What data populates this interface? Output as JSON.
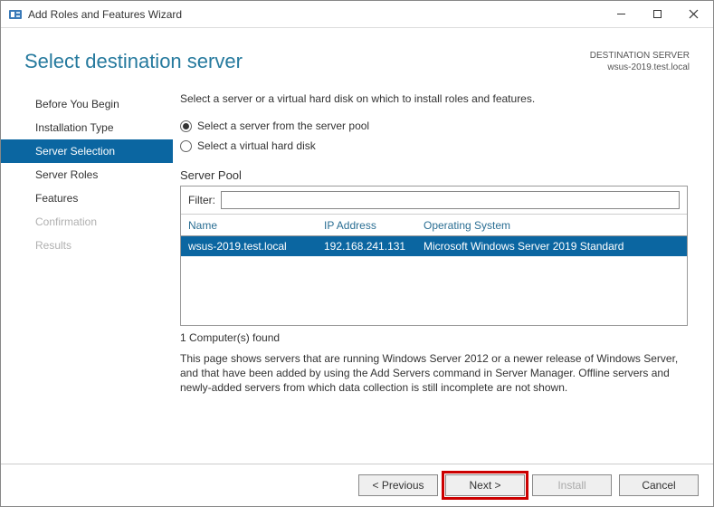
{
  "window": {
    "title": "Add Roles and Features Wizard"
  },
  "header": {
    "page_title": "Select destination server",
    "destination_label": "DESTINATION SERVER",
    "destination_value": "wsus-2019.test.local"
  },
  "sidebar": {
    "items": [
      {
        "label": "Before You Begin",
        "state": "normal"
      },
      {
        "label": "Installation Type",
        "state": "normal"
      },
      {
        "label": "Server Selection",
        "state": "active"
      },
      {
        "label": "Server Roles",
        "state": "normal"
      },
      {
        "label": "Features",
        "state": "normal"
      },
      {
        "label": "Confirmation",
        "state": "disabled"
      },
      {
        "label": "Results",
        "state": "disabled"
      }
    ]
  },
  "main": {
    "instruction": "Select a server or a virtual hard disk on which to install roles and features.",
    "radios": [
      {
        "label": "Select a server from the server pool",
        "selected": true
      },
      {
        "label": "Select a virtual hard disk",
        "selected": false
      }
    ],
    "pool_label": "Server Pool",
    "filter_label": "Filter:",
    "filter_value": "",
    "columns": {
      "name": "Name",
      "ip": "IP Address",
      "os": "Operating System"
    },
    "rows": [
      {
        "name": "wsus-2019.test.local",
        "ip": "192.168.241.131",
        "os": "Microsoft Windows Server 2019 Standard",
        "selected": true
      }
    ],
    "count_text": "1 Computer(s) found",
    "description": "This page shows servers that are running Windows Server 2012 or a newer release of Windows Server, and that have been added by using the Add Servers command in Server Manager. Offline servers and newly-added servers from which data collection is still incomplete are not shown."
  },
  "footer": {
    "previous": "< Previous",
    "next": "Next >",
    "install": "Install",
    "cancel": "Cancel"
  }
}
